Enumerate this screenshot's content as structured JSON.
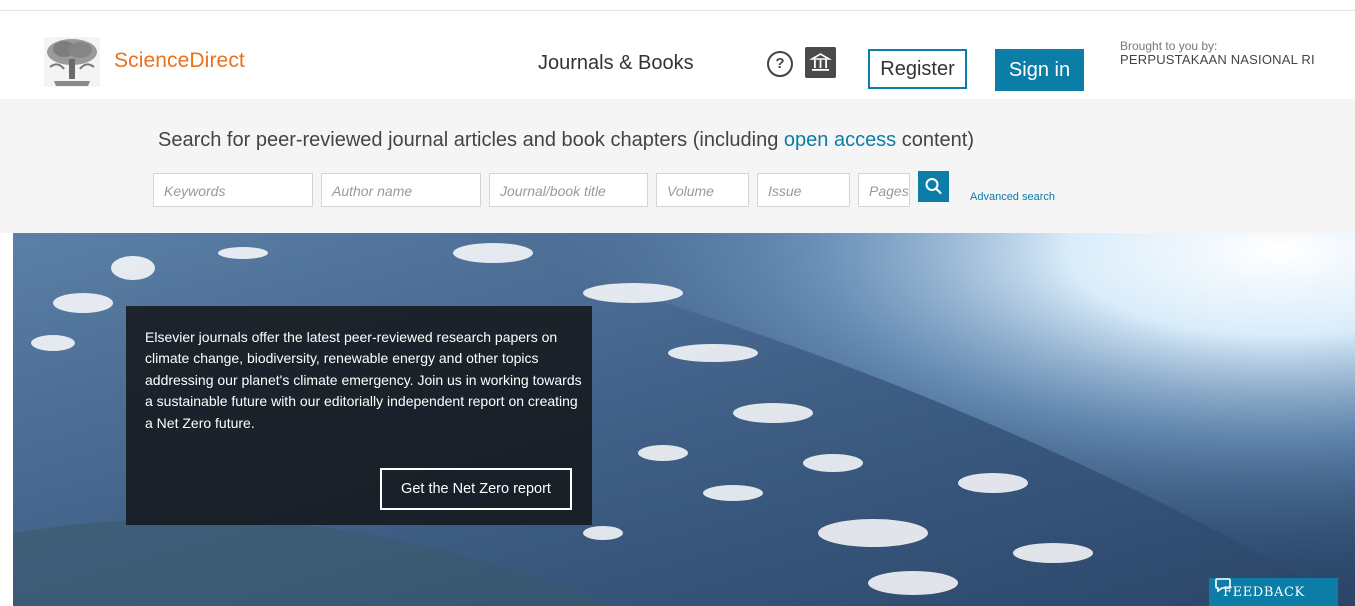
{
  "header": {
    "brand": "ScienceDirect",
    "journals_link": "Journals & Books",
    "help_icon": "?",
    "register_label": "Register",
    "signin_label": "Sign in",
    "brought_by": "Brought to you by:",
    "institution": "PERPUSTAKAAN NASIONAL RI"
  },
  "search": {
    "title_pre": "Search for peer-reviewed journal articles and book chapters (including ",
    "title_link": "open access",
    "title_post": " content)",
    "fields": {
      "keywords": "Keywords",
      "author": "Author name",
      "journal": "Journal/book title",
      "volume": "Volume",
      "issue": "Issue",
      "pages": "Pages"
    },
    "advanced": "Advanced search"
  },
  "hero": {
    "promo_text": "Elsevier journals offer the latest peer-reviewed research papers on climate change, biodiversity, renewable energy and other topics addressing our planet's climate emergency. Join us in working towards a sustainable future with our editorially independent report on creating a Net Zero future.",
    "promo_button": "Get the Net Zero report",
    "feedback": "FEEDBACK"
  },
  "colors": {
    "accent": "#0c7da7",
    "brand": "#e9711c"
  },
  "icons": [
    "elsevier-tree-logo",
    "help-icon",
    "institution-icon",
    "search-icon",
    "feedback-speech-icon"
  ]
}
